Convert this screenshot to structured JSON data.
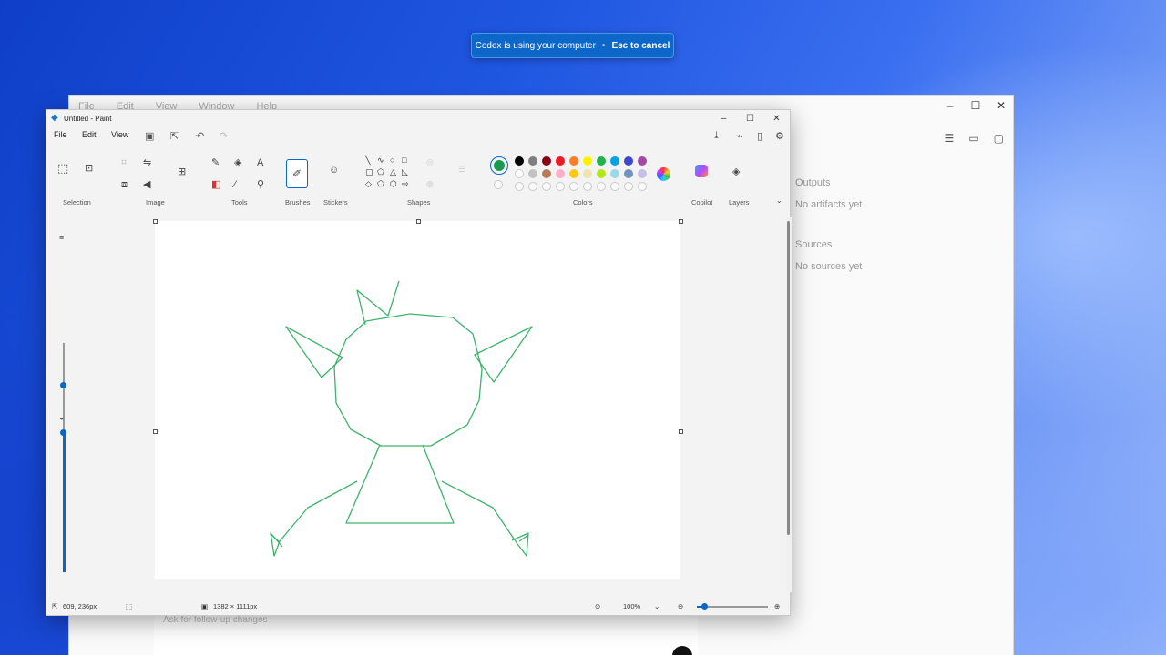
{
  "toast": {
    "message": "Codex is using your computer",
    "separator": "•",
    "action": "Esc to cancel"
  },
  "codex": {
    "menu": [
      "File",
      "Edit",
      "View",
      "Window",
      "Help"
    ],
    "outputs_heading": "Outputs",
    "outputs_empty": "No artifacts yet",
    "sources_heading": "Sources",
    "sources_empty": "No sources yet",
    "prompt_placeholder": "Ask for follow-up changes"
  },
  "paint": {
    "title": "Untitled - Paint",
    "menu": {
      "file": "File",
      "edit": "Edit",
      "view": "View"
    },
    "groups": {
      "selection": "Selection",
      "image": "Image",
      "tools": "Tools",
      "brushes": "Brushes",
      "stickers": "Stickers",
      "shapes": "Shapes",
      "colors": "Colors",
      "copilot": "Copilot",
      "layers": "Layers"
    },
    "colors": {
      "primary": "#1a9a50",
      "stroke": "#3db36b",
      "palette_row1": [
        "#000000",
        "#7f7f7f",
        "#880015",
        "#ed1c24",
        "#ff7f27",
        "#fff200",
        "#22b14c",
        "#00a2e8",
        "#3f48cc",
        "#a349a4"
      ],
      "palette_row2": [
        "#ffffff",
        "#c3c3c3",
        "#b97a57",
        "#ffaec9",
        "#ffc90e",
        "#efe4b0",
        "#b5e61d",
        "#99d9ea",
        "#7092be",
        "#c8bfe7"
      ]
    },
    "status": {
      "cursor": "609, 236px",
      "canvas_size": "1382 × 1111px",
      "zoom": "100%"
    }
  }
}
